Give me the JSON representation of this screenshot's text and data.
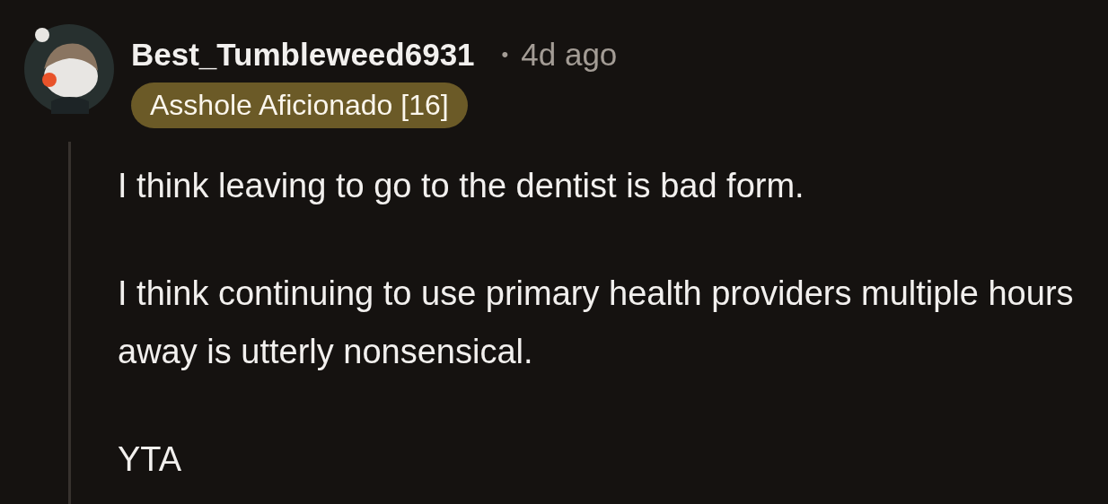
{
  "comment": {
    "author": "Best_Tumbleweed6931",
    "separator": "•",
    "time": "4d ago",
    "flair": "Asshole Aficionado [16]",
    "paragraphs": [
      "I think leaving to go to the dentist is bad form.",
      "I think continuing to use primary health providers multiple hours away is utterly nonsensical.",
      "YTA"
    ]
  }
}
